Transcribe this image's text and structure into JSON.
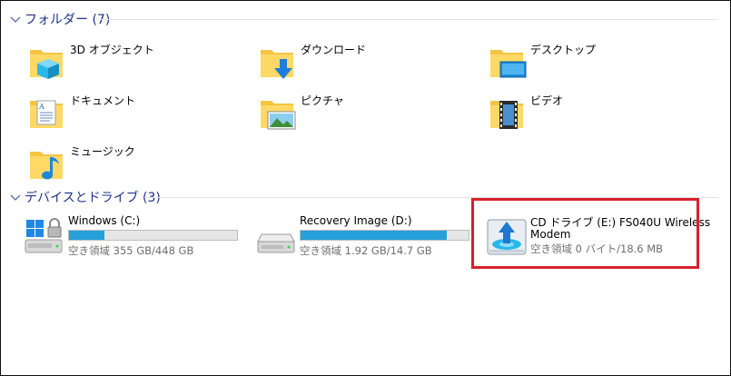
{
  "folders_group": {
    "title": "フォルダー (7)"
  },
  "folders": [
    {
      "label": "3D オブジェクト",
      "icon": "3d-objects-icon"
    },
    {
      "label": "ダウンロード",
      "icon": "downloads-icon"
    },
    {
      "label": "デスクトップ",
      "icon": "desktop-icon"
    },
    {
      "label": "ドキュメント",
      "icon": "documents-icon"
    },
    {
      "label": "ピクチャ",
      "icon": "pictures-icon"
    },
    {
      "label": "ビデオ",
      "icon": "videos-icon"
    },
    {
      "label": "ミュージック",
      "icon": "music-icon"
    }
  ],
  "devices_group": {
    "title": "デバイスとドライブ (3)"
  },
  "drives": [
    {
      "name": "Windows (C:)",
      "free_text": "空き領域 355 GB/448 GB",
      "used_fraction": 0.21,
      "icon": "windows-drive-icon"
    },
    {
      "name": "Recovery Image (D:)",
      "free_text": "空き領域 1.92 GB/14.7 GB",
      "used_fraction": 0.87,
      "icon": "hard-drive-icon"
    },
    {
      "name": "CD ドライブ (E:) FS040U Wireless",
      "name_line2": "Modem",
      "free_text": "空き領域 0 バイト/18.6 MB",
      "icon": "cd-drive-icon"
    }
  ],
  "colors": {
    "accent": "#26a0da",
    "header_text": "#1e3287",
    "highlight": "#d9212c",
    "folder": "#ffd966"
  }
}
